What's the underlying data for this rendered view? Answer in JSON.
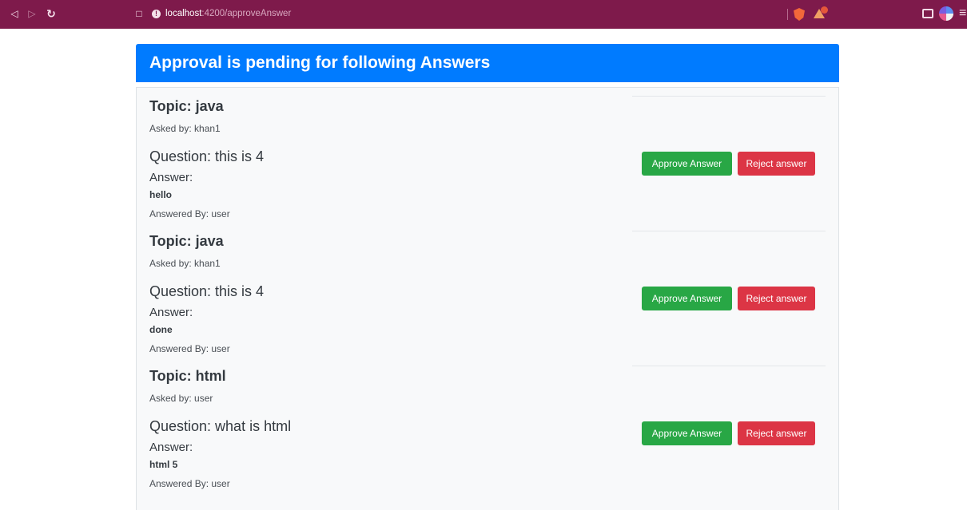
{
  "browser": {
    "url_host": "localhost",
    "url_path": ":4200/approveAnswer"
  },
  "page": {
    "title": "Approval is pending for following Answers"
  },
  "answers": [
    {
      "topic": "Topic: java",
      "asked_by": "Asked by: khan1",
      "question": "Question: this is 4",
      "answer_label": "Answer:",
      "answer_text": "hello",
      "answered_by": "Answered By: user",
      "approve_label": "Approve Answer",
      "reject_label": "Reject answer"
    },
    {
      "topic": "Topic: java",
      "asked_by": "Asked by: khan1",
      "question": "Question: this is 4",
      "answer_label": "Answer:",
      "answer_text": "done",
      "answered_by": "Answered By: user",
      "approve_label": "Approve Answer",
      "reject_label": "Reject answer"
    },
    {
      "topic": "Topic: html",
      "asked_by": "Asked by: user",
      "question": "Question: what is html",
      "answer_label": "Answer:",
      "answer_text": "html 5",
      "answered_by": "Answered By: user",
      "approve_label": "Approve Answer",
      "reject_label": "Reject answer"
    }
  ],
  "colors": {
    "browser_bar": "#7e1a4b",
    "header": "#007bff",
    "approve": "#28a745",
    "reject": "#dc3545",
    "panel": "#f8f9fa"
  }
}
